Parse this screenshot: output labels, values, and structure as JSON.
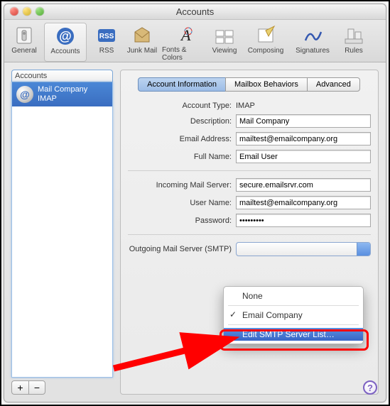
{
  "window": {
    "title": "Accounts"
  },
  "toolbar": {
    "items": [
      {
        "label": "General"
      },
      {
        "label": "Accounts"
      },
      {
        "label": "RSS"
      },
      {
        "label": "Junk Mail"
      },
      {
        "label": "Fonts & Colors"
      },
      {
        "label": "Viewing"
      },
      {
        "label": "Composing"
      },
      {
        "label": "Signatures"
      },
      {
        "label": "Rules"
      }
    ]
  },
  "sidebar": {
    "header": "Accounts",
    "item": {
      "name": "Mail Company",
      "type": "IMAP"
    },
    "add": "+",
    "remove": "−"
  },
  "tabs": {
    "info": "Account Information",
    "mailbox": "Mailbox Behaviors",
    "advanced": "Advanced"
  },
  "form": {
    "account_type_label": "Account Type:",
    "account_type_value": "IMAP",
    "description_label": "Description:",
    "description_value": "Mail Company",
    "email_label": "Email Address:",
    "email_value": "mailtest@emailcompany.org",
    "fullname_label": "Full Name:",
    "fullname_value": "Email User",
    "incoming_label": "Incoming Mail Server:",
    "incoming_value": "secure.emailsrvr.com",
    "username_label": "User Name:",
    "username_value": "mailtest@emailcompany.org",
    "password_label": "Password:",
    "password_value": "•••••••••",
    "smtp_label": "Outgoing Mail Server (SMTP)"
  },
  "popup": {
    "none": "None",
    "company": "Email Company",
    "edit": "Edit SMTP Server List…"
  },
  "help": "?"
}
